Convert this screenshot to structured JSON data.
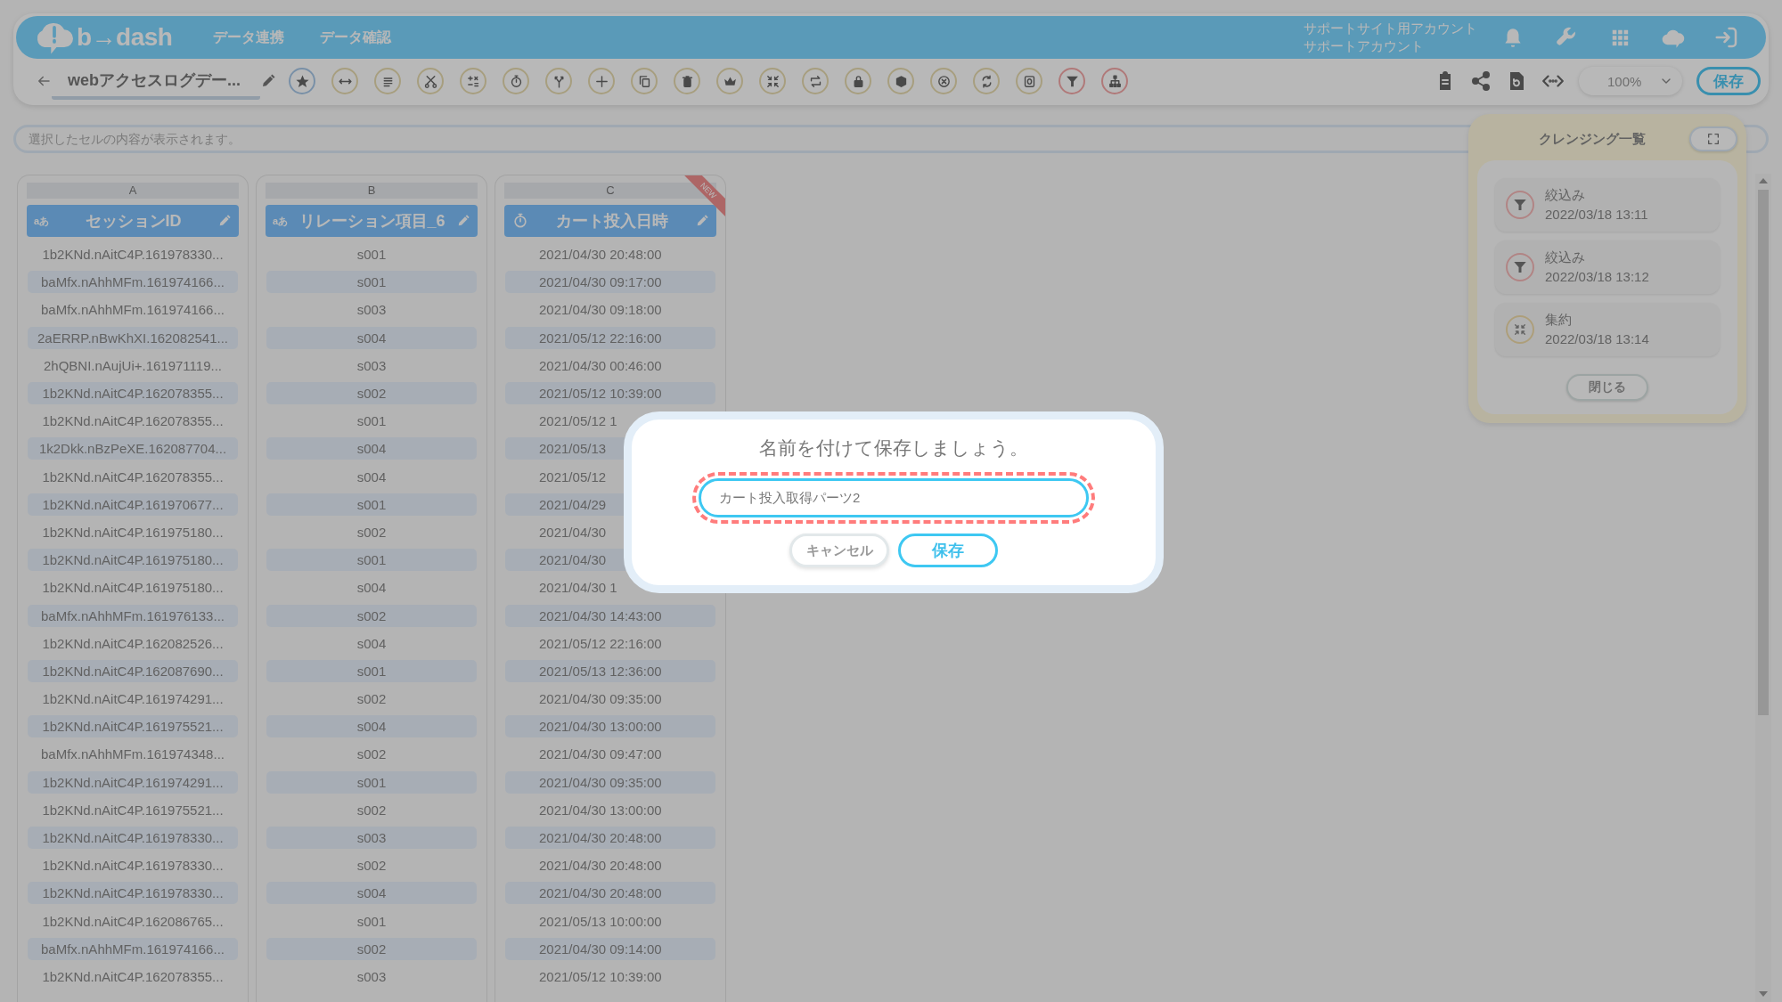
{
  "header": {
    "logo": "b→dash",
    "nav": [
      {
        "label": "データ連携"
      },
      {
        "label": "データ確認"
      }
    ],
    "account": [
      "サポートサイト用アカウント",
      "サポートアカウント"
    ]
  },
  "toolbar": {
    "title": "webアクセスログデー...",
    "zoom": "100%",
    "save": "保存"
  },
  "cell_viewer": {
    "placeholder": "選択したセルの内容が表示されます。"
  },
  "table": {
    "columns": [
      {
        "letter": "A",
        "kind": "text",
        "type_label": "aあ",
        "title": "セッションID"
      },
      {
        "letter": "B",
        "kind": "text",
        "type_label": "aあ",
        "title": "リレーション項目_6"
      },
      {
        "letter": "C",
        "kind": "datetime",
        "title": "カート投入日時",
        "badge": "NEW"
      }
    ],
    "rows": [
      [
        "1b2KNd.nAitC4P.161978330...",
        "s001",
        "2021/04/30 20:48:00"
      ],
      [
        "baMfx.nAhhMFm.161974166...",
        "s001",
        "2021/04/30 09:17:00"
      ],
      [
        "baMfx.nAhhMFm.161974166...",
        "s003",
        "2021/04/30 09:18:00"
      ],
      [
        "2aERRP.nBwKhXI.162082541...",
        "s004",
        "2021/05/12 22:16:00"
      ],
      [
        "2hQBNI.nAujUi+.161971119...",
        "s003",
        "2021/04/30 00:46:00"
      ],
      [
        "1b2KNd.nAitC4P.162078355...",
        "s002",
        "2021/05/12 10:39:00"
      ],
      [
        "1b2KNd.nAitC4P.162078355...",
        "s001",
        "2021/05/12 1"
      ],
      [
        "1k2Dkk.nBzPeXE.162087704...",
        "s004",
        "2021/05/13"
      ],
      [
        "1b2KNd.nAitC4P.162078355...",
        "s004",
        "2021/05/12"
      ],
      [
        "1b2KNd.nAitC4P.161970677...",
        "s001",
        "2021/04/29"
      ],
      [
        "1b2KNd.nAitC4P.161975180...",
        "s002",
        "2021/04/30"
      ],
      [
        "1b2KNd.nAitC4P.161975180...",
        "s001",
        "2021/04/30"
      ],
      [
        "1b2KNd.nAitC4P.161975180...",
        "s004",
        "2021/04/30 1"
      ],
      [
        "baMfx.nAhhMFm.161976133...",
        "s002",
        "2021/04/30 14:43:00"
      ],
      [
        "1b2KNd.nAitC4P.162082526...",
        "s004",
        "2021/05/12 22:16:00"
      ],
      [
        "1b2KNd.nAitC4P.162087690...",
        "s001",
        "2021/05/13 12:36:00"
      ],
      [
        "1b2KNd.nAitC4P.161974291...",
        "s002",
        "2021/04/30 09:35:00"
      ],
      [
        "1b2KNd.nAitC4P.161975521...",
        "s004",
        "2021/04/30 13:00:00"
      ],
      [
        "baMfx.nAhhMFm.161974348...",
        "s002",
        "2021/04/30 09:47:00"
      ],
      [
        "1b2KNd.nAitC4P.161974291...",
        "s001",
        "2021/04/30 09:35:00"
      ],
      [
        "1b2KNd.nAitC4P.161975521...",
        "s002",
        "2021/04/30 13:00:00"
      ],
      [
        "1b2KNd.nAitC4P.161978330...",
        "s003",
        "2021/04/30 20:48:00"
      ],
      [
        "1b2KNd.nAitC4P.161978330...",
        "s002",
        "2021/04/30 20:48:00"
      ],
      [
        "1b2KNd.nAitC4P.161978330...",
        "s004",
        "2021/04/30 20:48:00"
      ],
      [
        "1b2KNd.nAitC4P.162086765...",
        "s001",
        "2021/05/13 10:00:00"
      ],
      [
        "baMfx.nAhhMFm.161974166...",
        "s002",
        "2021/04/30 09:14:00"
      ],
      [
        "1b2KNd.nAitC4P.162078355...",
        "s003",
        "2021/05/12 10:39:00"
      ]
    ]
  },
  "cleansing_panel": {
    "title": "クレンジング一覧",
    "items": [
      {
        "kind": "filter",
        "label": "絞込み",
        "time": "2022/03/18 13:11"
      },
      {
        "kind": "filter",
        "label": "絞込み",
        "time": "2022/03/18 13:12"
      },
      {
        "kind": "aggregate",
        "label": "集約",
        "time": "2022/03/18 13:14"
      }
    ],
    "close": "閉じる"
  },
  "dialog": {
    "title": "名前を付けて保存しましょう。",
    "value": "カート投入取得パーツ2",
    "cancel": "キャンセル",
    "confirm": "保存"
  }
}
